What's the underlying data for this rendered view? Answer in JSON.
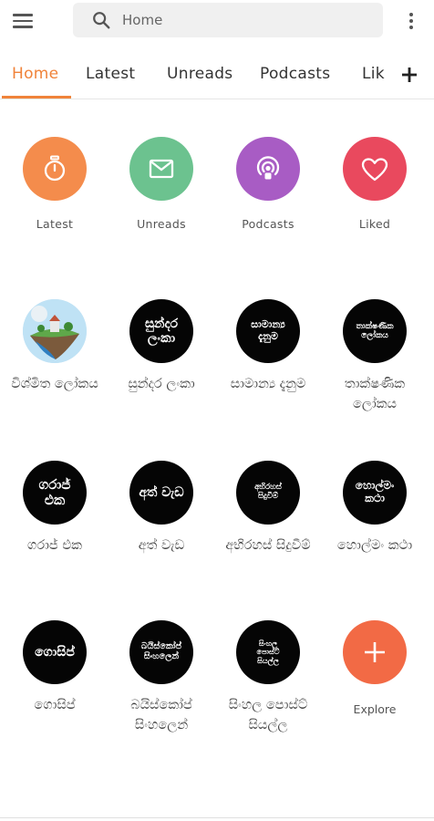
{
  "search": {
    "placeholder": "Home"
  },
  "tabs": [
    {
      "label": "Home",
      "active": true
    },
    {
      "label": "Latest"
    },
    {
      "label": "Unreads"
    },
    {
      "label": "Podcasts"
    },
    {
      "label": "Lik"
    }
  ],
  "quick_access": [
    {
      "label": "Latest",
      "icon": "stopwatch-icon",
      "color": "#f48c4c"
    },
    {
      "label": "Unreads",
      "icon": "envelope-icon",
      "color": "#6cc28f"
    },
    {
      "label": "Podcasts",
      "icon": "podcast-icon",
      "color": "#a85cc4"
    },
    {
      "label": "Liked",
      "icon": "heart-icon",
      "color": "#e9495e"
    }
  ],
  "channels": [
    {
      "name": "විශ්මිත ලෝකය",
      "logo_text": []
    },
    {
      "name": "සුන්දර ලංකා",
      "logo_text": [
        "සුන්දර",
        "ලංකා"
      ]
    },
    {
      "name": "සාමාන්‍ය දැනුම",
      "logo_text": [
        "සාමාන්‍ය",
        "දැනුම"
      ]
    },
    {
      "name": "තාක්ෂණික ලෝකය",
      "logo_text": [
        "තාක්ෂණික",
        "ලෝකය"
      ]
    },
    {
      "name": "ගරාජ් එක",
      "logo_text": [
        "ගරාජ්",
        "එක"
      ]
    },
    {
      "name": "අත් වැඩ",
      "logo_text": [
        "අත් වැඩ"
      ]
    },
    {
      "name": "අභිරහස් සිදුවීම්",
      "logo_text": [
        "අභිරහස්",
        "සිදුවීම්"
      ]
    },
    {
      "name": "හොල්මං කථා",
      "logo_text": [
        "හොල්මං",
        "කථා"
      ]
    },
    {
      "name": "ගොසිප්",
      "logo_text": [
        "ගොසිප්"
      ]
    },
    {
      "name": "බයිස්කෝප් සිංහලෙන්",
      "logo_text": [
        "බයිස්කෝප්",
        "සිංහලෙන්"
      ]
    },
    {
      "name": "සිංහල පොස්ට් සියල්ල",
      "logo_text": [
        "සිංහල",
        "පොස්ට්",
        "සියල්ල"
      ]
    }
  ],
  "explore": {
    "label": "Explore"
  },
  "colors": {
    "accent": "#f0833a",
    "explore": "#f26a45"
  }
}
